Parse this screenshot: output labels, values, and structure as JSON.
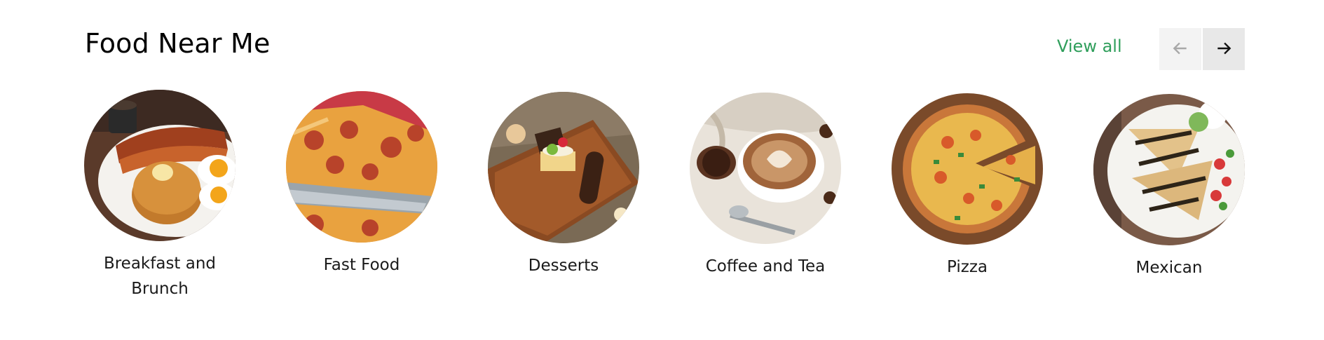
{
  "section": {
    "title": "Food Near Me",
    "view_all_label": "View all",
    "prev_icon": "arrow-left-icon",
    "next_icon": "arrow-right-icon",
    "accent_color": "#2f9e5b"
  },
  "categories": [
    {
      "label": "Breakfast and Brunch",
      "image": "pancakes-bacon-eggs-image"
    },
    {
      "label": "Fast Food",
      "image": "pizza-slice-image"
    },
    {
      "label": "Desserts",
      "image": "dessert-platter-image"
    },
    {
      "label": "Coffee and Tea",
      "image": "latte-art-image"
    },
    {
      "label": "Pizza",
      "image": "whole-pizza-image"
    },
    {
      "label": "Mexican",
      "image": "quesadilla-image"
    }
  ]
}
